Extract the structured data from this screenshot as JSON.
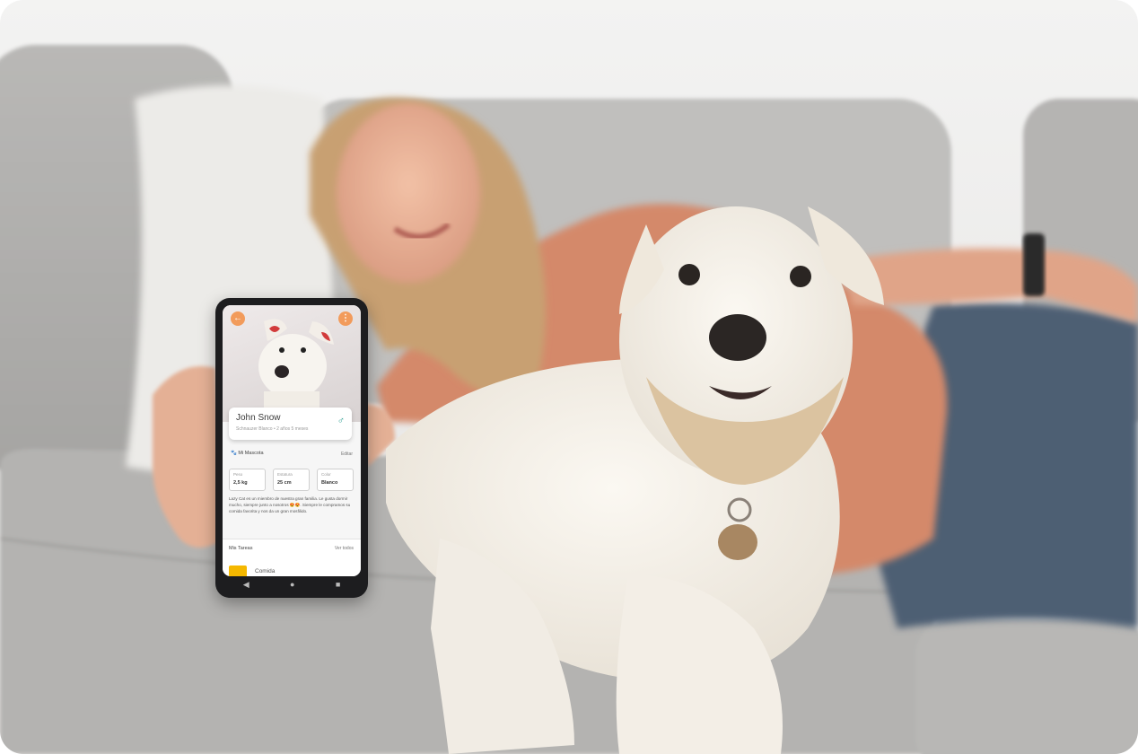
{
  "app": {
    "pet_name": "John Snow",
    "pet_subtitle": "Schnauzer Blanco • 2 años 5 meses",
    "gender_symbol": "♂",
    "section_title": "Mi Mascota",
    "edit_label": "Editar",
    "stats": [
      {
        "label": "Peso",
        "value": "2,5 kg"
      },
      {
        "label": "Estatura",
        "value": "25 cm"
      },
      {
        "label": "Color",
        "value": "Blanco"
      }
    ],
    "description": "Lazy Cat es un miembro de nuestra gran familia. Le gusta dormir mucho, siempre junto a nosotros 😍😍. Siempre le compramos su comida favorita y nos da un gran mosfilido.",
    "tasks_title": "Mis Tareas",
    "tasks_link": "Ver todos",
    "task_item": "Comida",
    "back_icon": "←",
    "menu_icon": "⋮",
    "nav_icons": [
      "◀",
      "●",
      "■"
    ]
  },
  "colors": {
    "accent": "#f29b5b",
    "gender": "#2a9d8f",
    "task_icon": "#f5b800"
  }
}
